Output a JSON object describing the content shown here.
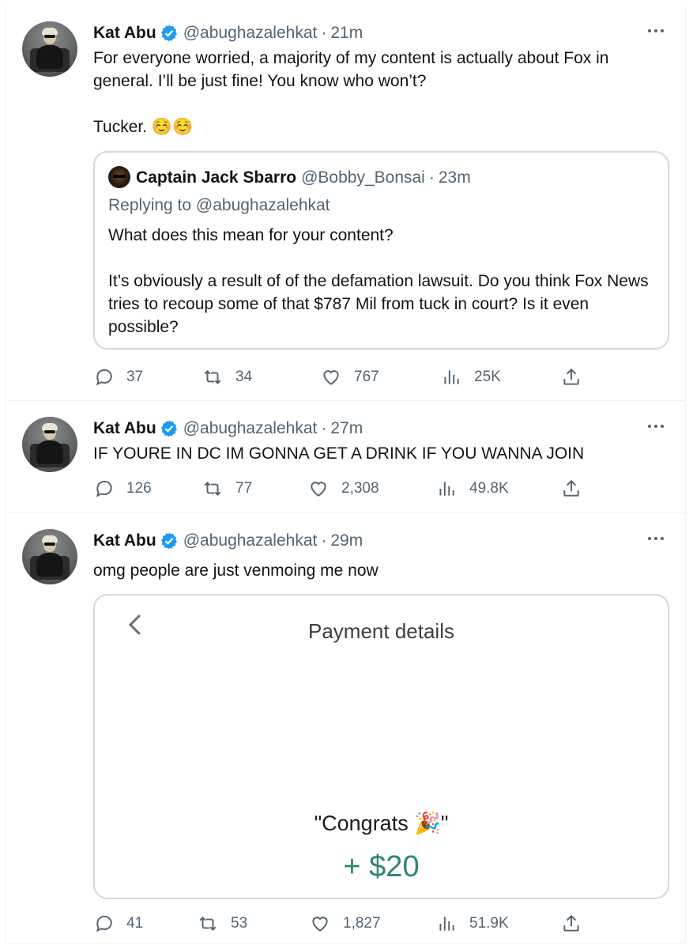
{
  "colors": {
    "text": "#0f1419",
    "secondary": "#536471",
    "border": "#cfd9de",
    "verified": "#1d9bf0",
    "amount": "#2e8574"
  },
  "tweets": [
    {
      "name": "Kat Abu",
      "handle": "@abughazalehkat",
      "dot": "·",
      "time": "21m",
      "text": "For everyone worried, a majority of my content is actually about Fox in general. I’ll be just fine! You know who won’t?\n\nTucker. ☺️☺️",
      "quote": {
        "name": "Captain Jack Sbarro",
        "handle": "@Bobby_Bonsai",
        "dot": "·",
        "time": "23m",
        "replying": "Replying to @abughazalehkat",
        "text": "What does this mean for your content?\n\nIt’s obviously a result of of the defamation lawsuit. Do you think Fox News tries to recoup some of that $787 Mil from tuck in court? Is it even possible?"
      },
      "replies": "37",
      "retweets": "34",
      "likes": "767",
      "views": "25K"
    },
    {
      "name": "Kat Abu",
      "handle": "@abughazalehkat",
      "dot": "·",
      "time": "27m",
      "text": "IF YOURE IN DC IM GONNA GET A DRINK IF YOU WANNA JOIN",
      "replies": "126",
      "retweets": "77",
      "likes": "2,308",
      "views": "49.8K"
    },
    {
      "name": "Kat Abu",
      "handle": "@abughazalehkat",
      "dot": "·",
      "time": "29m",
      "text": "omg people are just venmoing me now",
      "card": {
        "title": "Payment details",
        "message": "\"Congrats 🎉\"",
        "amount": "+ $20"
      },
      "replies": "41",
      "retweets": "53",
      "likes": "1,827",
      "views": "51.9K"
    }
  ],
  "icons": [
    "reply-icon",
    "retweet-icon",
    "like-icon",
    "views-icon",
    "share-icon",
    "verified-badge-icon",
    "more-options-icon",
    "back-chevron-icon"
  ]
}
